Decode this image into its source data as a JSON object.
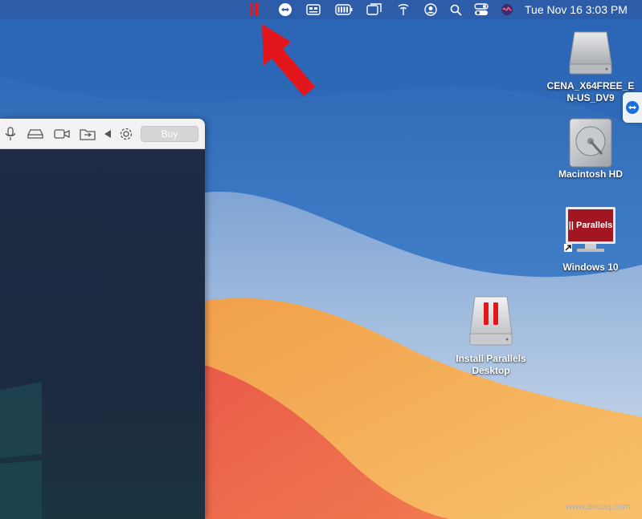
{
  "menubar": {
    "items": [
      "parallels-icon",
      "teamviewer-icon",
      "keyboard-icon",
      "battery-icon",
      "screens-icon",
      "wifi-icon",
      "user-icon",
      "search-icon",
      "control-center-icon",
      "siri-icon"
    ],
    "clock": "Tue Nov 16  3:03 PM"
  },
  "vm_window": {
    "toolbar_icons": [
      "microphone-icon",
      "disk-icon",
      "camera-icon",
      "shared-folder-icon",
      "collapse-arrow-icon",
      "settings-icon"
    ],
    "buy_label": "Buy"
  },
  "desktop": {
    "icons": [
      {
        "icon": "external-drive-icon",
        "label_lines": [
          "CENA_X64FREE_E",
          "N-US_DV9"
        ]
      },
      {
        "icon": "hard-disk-icon",
        "label_lines": [
          "Macintosh HD"
        ]
      },
      {
        "icon": "parallels-vm-icon",
        "label_lines": [
          "Windows 10"
        ],
        "thumb_text": "|| Parallels"
      },
      {
        "icon": "installer-disk-icon",
        "label_lines": [
          "Install Parallels",
          "Desktop"
        ]
      }
    ]
  },
  "annotation": {
    "arrow_color": "#e3161c",
    "points_to": "parallels-icon"
  },
  "watermark": "www.deuaq.com",
  "colors": {
    "accent_red": "#e3161c",
    "menubar": "#2e5ca8"
  }
}
